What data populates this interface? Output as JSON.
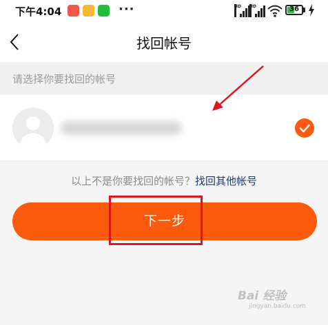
{
  "status_bar": {
    "time": "下午4:04",
    "more": "···",
    "signal_label": "HD",
    "battery": "36"
  },
  "header": {
    "title": "找回帐号"
  },
  "section": {
    "label": "请选择你要找回的帐号"
  },
  "account": {
    "selected": true
  },
  "hint": {
    "text": "以上不是你要找回的帐号？",
    "link": "找回其他帐号"
  },
  "actions": {
    "next_label": "下一步"
  },
  "watermark": {
    "brand": "Bai 经验",
    "url": "jingyan.baidu.com"
  },
  "colors": {
    "accent": "#fc5b0d",
    "link": "#1e3a6e",
    "annotation": "#e0141e"
  }
}
